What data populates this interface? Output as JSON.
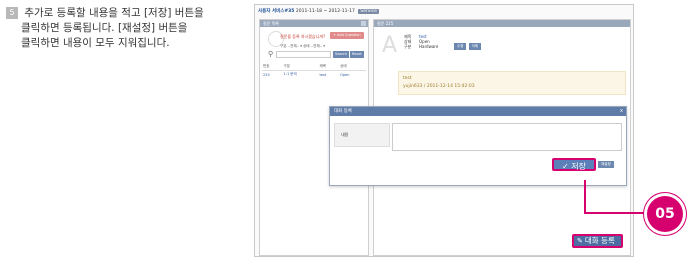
{
  "instruction": {
    "step": "5",
    "line1": "추가로 등록할 내용을 적고 [저장] 버튼을",
    "line2": "클릭하면 등록됩니다. [재설정] 버튼을",
    "line3": "클릭하면 내용이 모두 지워집니다."
  },
  "screenshot": {
    "topbar": {
      "title": "사용자 서비스#35",
      "range": "2011-11-18 ~ 2012-11-17",
      "tag": "Service"
    },
    "left_panel": {
      "header": "질문 목록",
      "question": "질문을 등록 하시겠습니까?",
      "add_button": "+ Add Question",
      "filter_type_label": "구분",
      "filter_type_value": "--전체--",
      "filter_state_label": "상태",
      "filter_state_value": "--전체--",
      "search_button": "Search",
      "reset_button": "Reset",
      "table": {
        "headers": [
          "번호",
          "구분",
          "제목",
          "상태"
        ],
        "rows": [
          {
            "num": "225",
            "type": "1:1 문의",
            "title": "test",
            "state": "Open"
          }
        ]
      }
    },
    "right_panel": {
      "header": "질문 225",
      "letter": "A",
      "fields": [
        {
          "key": "제목",
          "value": "test"
        },
        {
          "key": "상태",
          "value": "Open"
        },
        {
          "key": "구분",
          "value": "Hardware"
        }
      ],
      "edit_button": "수정",
      "delete_button": "삭제",
      "note_text": "test",
      "note_meta": "yujin633 / 2011-12-14 15:42:03"
    },
    "dialog": {
      "title": "대화 등록",
      "close": "x",
      "field_label": "내용",
      "save_button": "✓ 저장",
      "reset_button": "재설정"
    },
    "callout_number": "05",
    "conversation_button": "대화 등록"
  },
  "colors": {
    "accent": "#d6006f",
    "button_blue": "#5b7fb8",
    "header_gray": "#9aa8bc"
  }
}
